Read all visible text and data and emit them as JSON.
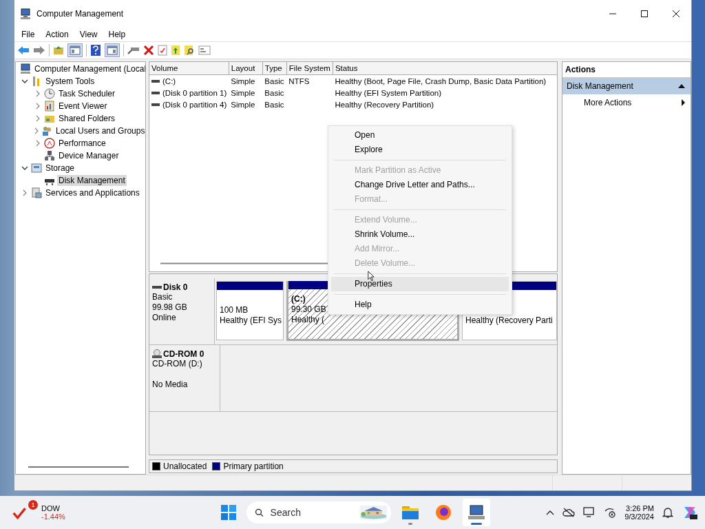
{
  "window": {
    "title": "Computer Management"
  },
  "menu": [
    "File",
    "Action",
    "View",
    "Help"
  ],
  "tree": [
    {
      "label": "Computer Management (Local",
      "selected": false,
      "children": [
        {
          "label": "System Tools",
          "expanded": true,
          "selected": false,
          "children": [
            {
              "label": "Task Scheduler",
              "expanded": false,
              "selected": false
            },
            {
              "label": "Event Viewer",
              "expanded": false,
              "selected": false
            },
            {
              "label": "Shared Folders",
              "expanded": false,
              "selected": false
            },
            {
              "label": "Local Users and Groups",
              "expanded": false,
              "selected": false
            },
            {
              "label": "Performance",
              "expanded": false,
              "selected": false
            },
            {
              "label": "Device Manager",
              "selected": false
            }
          ]
        },
        {
          "label": "Storage",
          "expanded": true,
          "selected": false,
          "children": [
            {
              "label": "Disk Management",
              "selected": true
            }
          ]
        },
        {
          "label": "Services and Applications",
          "expanded": false,
          "selected": false
        }
      ]
    }
  ],
  "volumes": {
    "columns": [
      "Volume",
      "Layout",
      "Type",
      "File System",
      "Status"
    ],
    "rows": [
      [
        "(C:)",
        "Simple",
        "Basic",
        "NTFS",
        "Healthy (Boot, Page File, Crash Dump, Basic Data Partition)"
      ],
      [
        "(Disk 0 partition 1)",
        "Simple",
        "Basic",
        "",
        "Healthy (EFI System Partition)"
      ],
      [
        "(Disk 0 partition 4)",
        "Simple",
        "Basic",
        "",
        "Healthy (Recovery Partition)"
      ]
    ]
  },
  "disks": [
    {
      "kind": "disk",
      "name": "Disk 0",
      "lines": [
        "Basic",
        "99.98 GB",
        "Online"
      ],
      "partitions": [
        {
          "size": "100 MB",
          "status": "Healthy (EFI Sys",
          "color": "#000080",
          "selected": false
        },
        {
          "name": "(C:)",
          "size": "99.30 GB",
          "status": "Healthy (",
          "color": "#000080",
          "selected": true
        },
        {
          "status": "Healthy (Recovery Parti",
          "color": "#000080",
          "selected": false
        }
      ]
    },
    {
      "kind": "cdrom",
      "name": "CD-ROM 0",
      "lines": [
        "CD-ROM (D:)",
        "No Media"
      ]
    }
  ],
  "legend": [
    {
      "label": "Unallocated",
      "color": "#000000"
    },
    {
      "label": "Primary partition",
      "color": "#000080"
    }
  ],
  "actions": {
    "title": "Actions",
    "section": "Disk Management",
    "items": [
      "More Actions"
    ]
  },
  "context_menu": [
    [
      {
        "label": "Open",
        "disabled": false,
        "highlighted": false
      },
      {
        "label": "Explore",
        "disabled": false,
        "highlighted": false
      }
    ],
    [
      {
        "label": "Mark Partition as Active",
        "disabled": true,
        "highlighted": false
      },
      {
        "label": "Change Drive Letter and Paths...",
        "disabled": false,
        "highlighted": false
      },
      {
        "label": "Format...",
        "disabled": true,
        "highlighted": false
      }
    ],
    [
      {
        "label": "Extend Volume...",
        "disabled": true,
        "highlighted": false
      },
      {
        "label": "Shrink Volume...",
        "disabled": false,
        "highlighted": false
      },
      {
        "label": "Add Mirror...",
        "disabled": true,
        "highlighted": false
      },
      {
        "label": "Delete Volume...",
        "disabled": true,
        "highlighted": false
      }
    ],
    [
      {
        "label": "Properties",
        "disabled": false,
        "highlighted": true
      }
    ],
    [
      {
        "label": "Help",
        "disabled": false,
        "highlighted": false
      }
    ]
  ],
  "taskbar": {
    "widget": {
      "badge": "1",
      "name": "DOW",
      "change": "-1.44%"
    },
    "search": {
      "placeholder": "Search"
    },
    "apps": [
      {
        "kind": "folder",
        "running": true,
        "active": false
      },
      {
        "kind": "browser",
        "running": false,
        "active": false
      },
      {
        "kind": "console",
        "running": true,
        "active": true
      }
    ],
    "time": "3:26 PM",
    "date": "9/3/2024"
  }
}
